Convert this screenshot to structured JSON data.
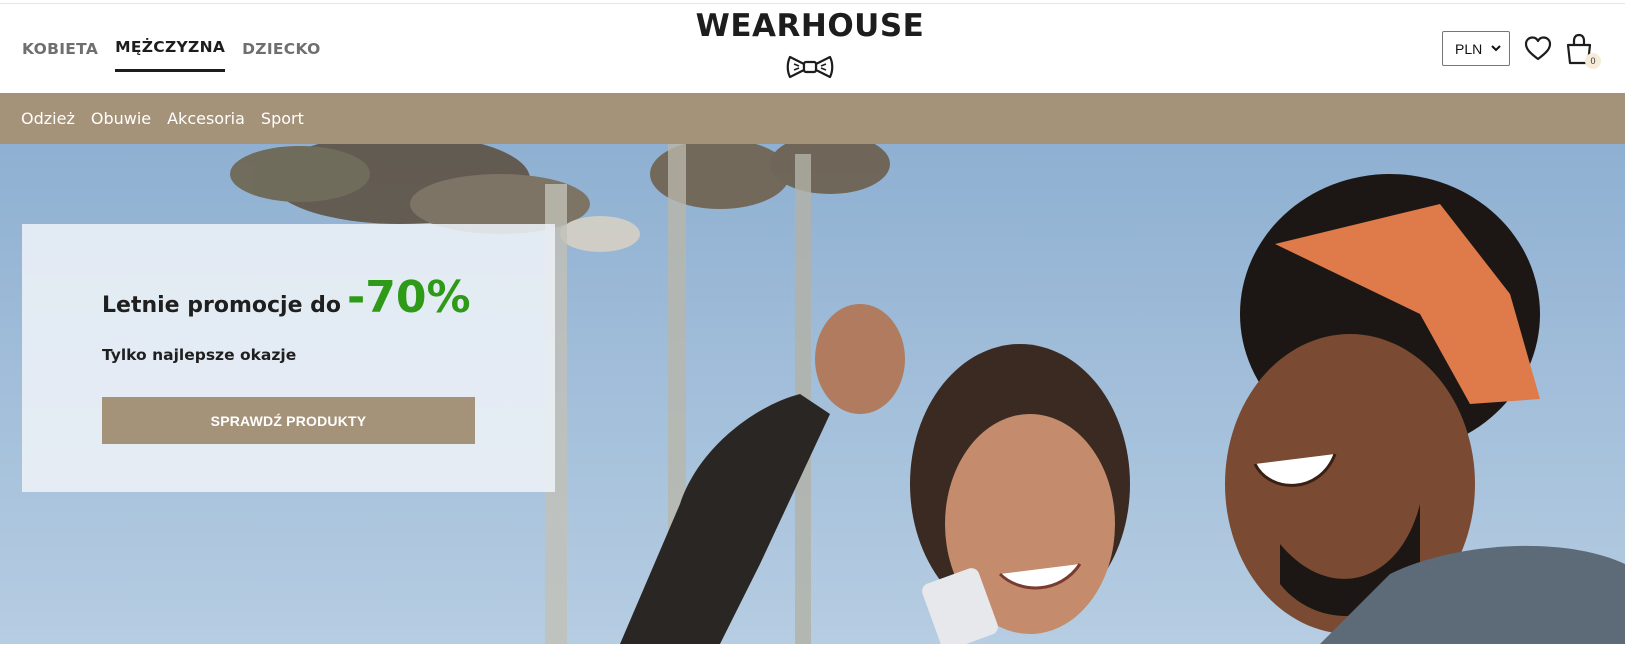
{
  "brand": {
    "name": "WEARHOUSE",
    "logo_icon": "bowtie-icon"
  },
  "gender_nav": [
    {
      "label": "KOBIETA",
      "active": false
    },
    {
      "label": "MĘŻCZYZNA",
      "active": true
    },
    {
      "label": "DZIECKO",
      "active": false
    }
  ],
  "toolbar": {
    "currency": "PLN",
    "wishlist_icon": "heart-icon",
    "cart_icon": "shopping-bag-icon",
    "cart_count": "0"
  },
  "categories": [
    "Odzież",
    "Obuwie",
    "Akcesoria",
    "Sport"
  ],
  "hero": {
    "heading": "Letnie promocje do",
    "discount": "-70%",
    "subheading": "Tylko najlepsze okazje",
    "cta_label": "SPRAWDŹ PRODUKTY"
  },
  "colors": {
    "accent": "#a59379",
    "discount_green": "#2e9a18",
    "text_dark": "#1d1d1d",
    "sky": "#9dbad6"
  }
}
